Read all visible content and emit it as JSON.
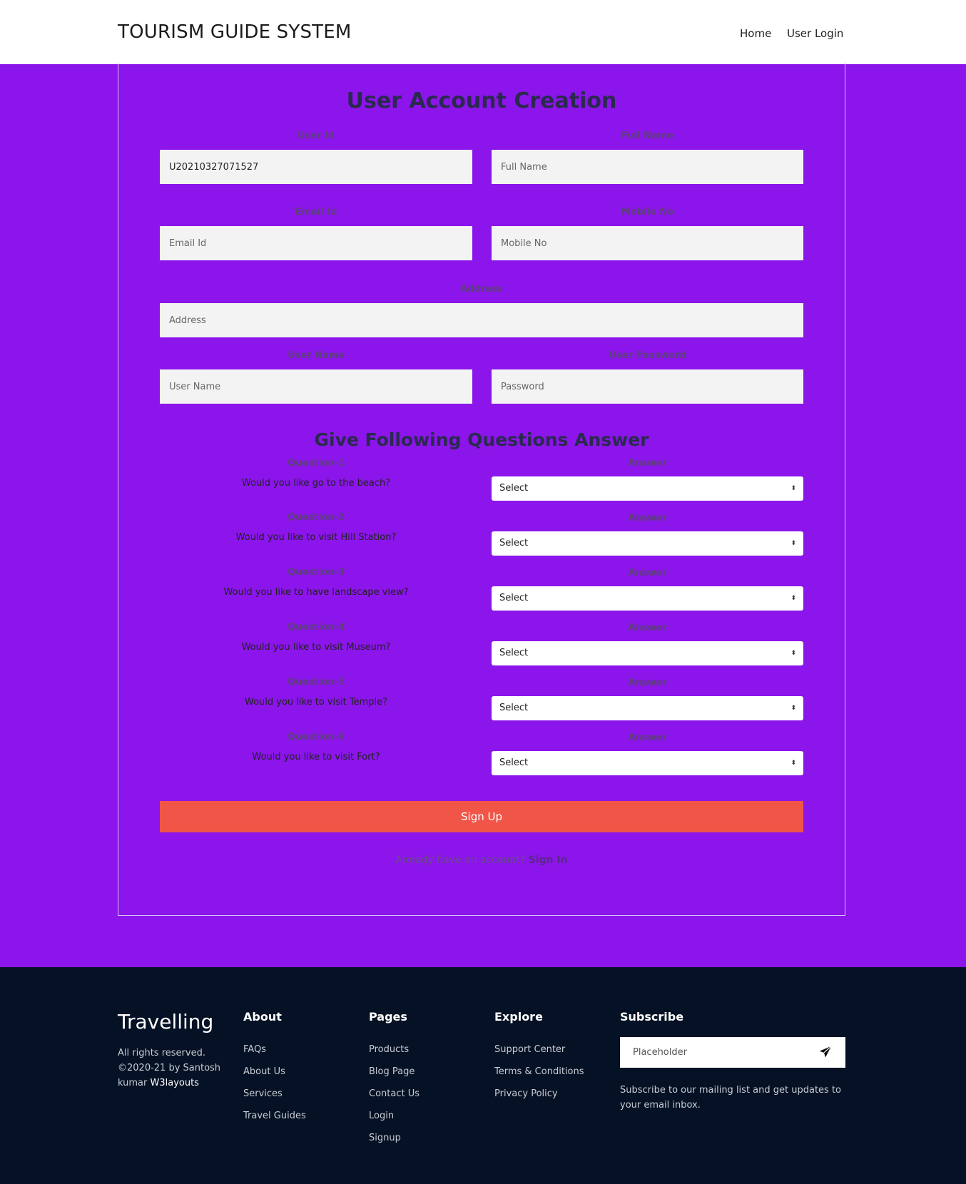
{
  "header": {
    "brand": "TOURISM GUIDE SYSTEM",
    "nav": [
      "Home",
      "User Login"
    ]
  },
  "form": {
    "title": "User Account Creation",
    "fields": {
      "user_id": {
        "label": "User Id",
        "value": "U20210327071527"
      },
      "full_name": {
        "label": "Full Name",
        "placeholder": "Full Name"
      },
      "email": {
        "label": "Email Id",
        "placeholder": "Email Id"
      },
      "mobile": {
        "label": "Mobile No",
        "placeholder": "Mobile No"
      },
      "address": {
        "label": "Address",
        "placeholder": "Address"
      },
      "username": {
        "label": "User Name",
        "placeholder": "User Name"
      },
      "password": {
        "label": "User Password",
        "placeholder": "Password"
      }
    },
    "questions_title": "Give Following Questions Answer",
    "questions": [
      {
        "label": "Question-1",
        "text": "Would you like go to the beach?",
        "answer_label": "Answer",
        "selected": "Select"
      },
      {
        "label": "Question-2",
        "text": "Would you like to visit Hill Station?",
        "answer_label": "Answer",
        "selected": "Select"
      },
      {
        "label": "Question-3",
        "text": "Would you like to have landscape view?",
        "answer_label": "Answer",
        "selected": "Select"
      },
      {
        "label": "Question-4",
        "text": "Would you like to visit Museum?",
        "answer_label": "Answer",
        "selected": "Select"
      },
      {
        "label": "Question-5",
        "text": "Would you like to visit Temple?",
        "answer_label": "Answer",
        "selected": "Select"
      },
      {
        "label": "Question-6",
        "text": "Would you like to visit Fort?",
        "answer_label": "Answer",
        "selected": "Select"
      }
    ],
    "submit_label": "Sign Up",
    "signin_prompt": "Already have an account?",
    "signin_link": "Sign In"
  },
  "footer": {
    "brand": "Travelling",
    "copyright_line1": "All rights reserved. ©2020-21 by Santosh kumar",
    "copyright_link": "W3layouts",
    "columns": [
      {
        "title": "About",
        "items": [
          "FAQs",
          "About Us",
          "Services",
          "Travel Guides"
        ]
      },
      {
        "title": "Pages",
        "items": [
          "Products",
          "Blog Page",
          "Contact Us",
          "Login",
          "Signup"
        ]
      },
      {
        "title": "Explore",
        "items": [
          "Support Center",
          "Terms & Conditions",
          "Privacy Policy"
        ]
      }
    ],
    "subscribe": {
      "title": "Subscribe",
      "placeholder": "Placeholder",
      "text": "Subscribe to our mailing list and get updates to your email inbox.",
      "send_icon": "paper-plane-icon"
    }
  },
  "colors": {
    "page_bg": "#8b15ea",
    "header_bg": "#ffffff",
    "button_bg": "#f05548",
    "footer_bg": "#051124"
  }
}
